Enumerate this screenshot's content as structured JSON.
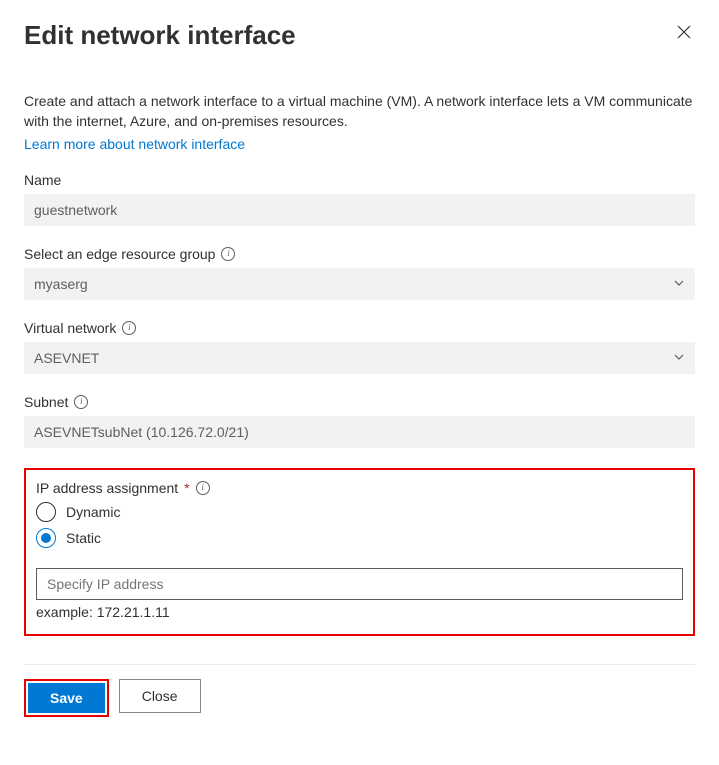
{
  "header": {
    "title": "Edit network interface"
  },
  "description": "Create and attach a network interface to a virtual machine (VM). A network interface lets a VM communicate with the internet, Azure, and on-premises resources.",
  "learn_more": "Learn more about network interface",
  "fields": {
    "name": {
      "label": "Name",
      "value": "guestnetwork"
    },
    "resource_group": {
      "label": "Select an edge resource group",
      "value": "myaserg"
    },
    "vnet": {
      "label": "Virtual network",
      "value": "ASEVNET"
    },
    "subnet": {
      "label": "Subnet",
      "value": "ASEVNETsubNet (10.126.72.0/21)"
    },
    "ip_assignment": {
      "label": "IP address assignment",
      "options": {
        "dynamic": "Dynamic",
        "static": "Static"
      },
      "ip_placeholder": "Specify IP address",
      "example": "example: 172.21.1.11"
    }
  },
  "footer": {
    "save": "Save",
    "close": "Close"
  }
}
